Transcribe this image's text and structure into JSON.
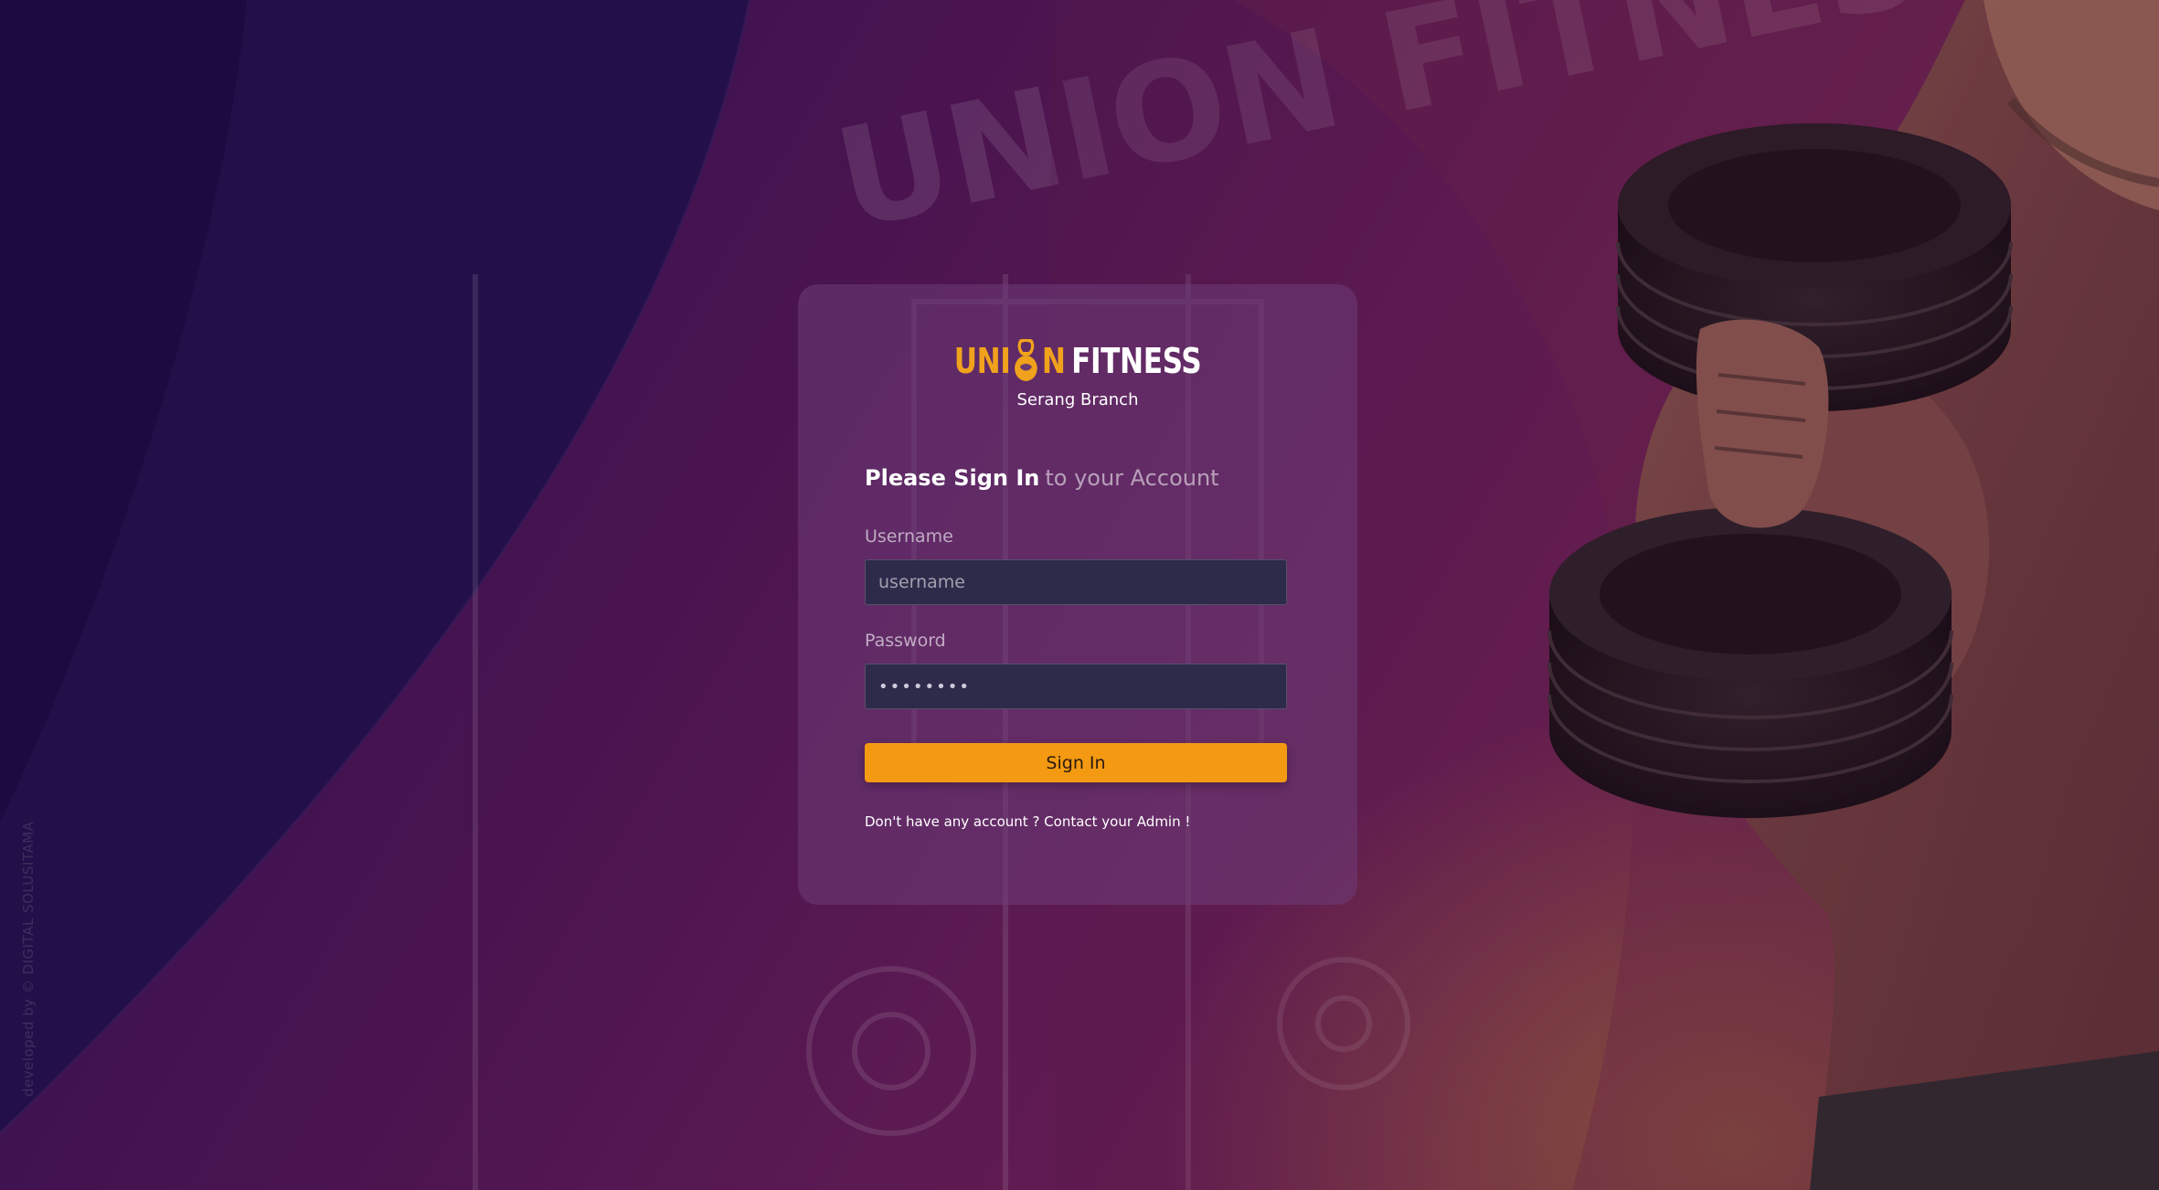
{
  "brand": {
    "logo_part1": "UNI",
    "logo_part2": "N",
    "logo_part3": "FITNESS",
    "branch": "Serang Branch",
    "accent_color": "#f0a21c"
  },
  "heading": {
    "strong": "Please Sign In",
    "soft": "to your Account"
  },
  "form": {
    "username_label": "Username",
    "username_placeholder": "username",
    "username_value": "",
    "password_label": "Password",
    "password_value": "••••••••",
    "submit_label": "Sign In",
    "submit_color": "#f39a12"
  },
  "footer_note": "Don't have any account ? Contact your Admin !",
  "credit": "developed by © DIGITAL SOLUSITAMA",
  "background": {
    "watermark_text": "UNION FITNESS",
    "hero_image": "man-lifting-dumbbell"
  }
}
